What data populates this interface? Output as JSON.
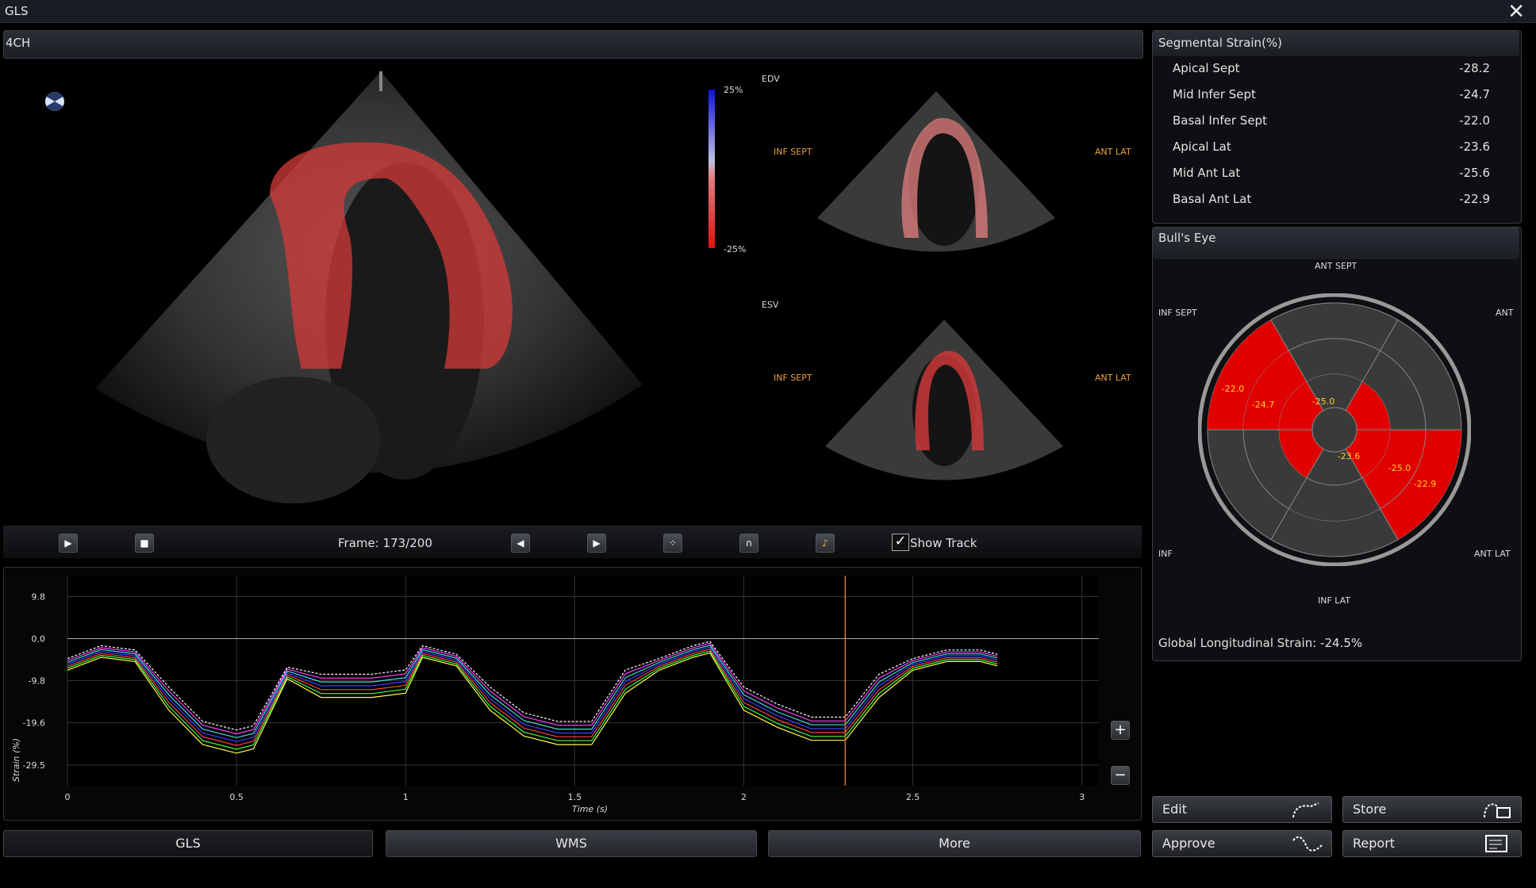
{
  "window": {
    "title": "GLS",
    "close_icon": "close-icon"
  },
  "viewport": {
    "view_label": "4CH",
    "colorbar": {
      "top": "25%",
      "bottom": "-25%"
    },
    "edv_label": "EDV",
    "esv_label": "ESV",
    "edv_left": "INF SEPT",
    "edv_right": "ANT LAT",
    "esv_left": "INF SEPT",
    "esv_right": "ANT LAT"
  },
  "controls": {
    "frame_text": "Frame: 173/200",
    "show_track_label": "Show Track",
    "show_track_checked": true
  },
  "graph": {
    "y_label": "Strain (%)",
    "x_label": "Time (s)",
    "y_ticks": [
      "9.8",
      "0.0",
      "-9.8",
      "-19.6",
      "-29.5"
    ],
    "x_ticks": [
      "0",
      "0.5",
      "1",
      "1.5",
      "2",
      "2.5",
      "3"
    ],
    "cursor_time": 2.3
  },
  "tabs": [
    {
      "label": "GLS"
    },
    {
      "label": "WMS"
    },
    {
      "label": "More"
    }
  ],
  "segmental": {
    "title": "Segmental Strain(%)",
    "rows": [
      {
        "name": "Apical Sept",
        "value": "-28.2"
      },
      {
        "name": "Mid Infer Sept",
        "value": "-24.7"
      },
      {
        "name": "Basal Infer Sept",
        "value": "-22.0"
      },
      {
        "name": "Apical Lat",
        "value": "-23.6"
      },
      {
        "name": "Mid Ant Lat",
        "value": "-25.6"
      },
      {
        "name": "Basal Ant Lat",
        "value": "-22.9"
      }
    ]
  },
  "bullseye": {
    "title": "Bull's Eye",
    "label_top": "ANT SEPT",
    "label_upper_left": "INF SEPT",
    "label_upper_right": "ANT",
    "label_lower_left": "INF",
    "label_lower_right": "ANT LAT",
    "label_bottom": "INF LAT",
    "values": [
      "-22.0",
      "-24.7",
      "-25.0",
      "-23.6",
      "-25.0",
      "-22.9"
    ],
    "gls_text": "Global Longitudinal Strain: -24.5%"
  },
  "actions": {
    "edit": "Edit",
    "store": "Store",
    "approve": "Approve",
    "report": "Report"
  },
  "colors": {
    "strain_red": "#e00000",
    "cursor": "#c87832",
    "accent_orange": "#e8a040"
  }
}
